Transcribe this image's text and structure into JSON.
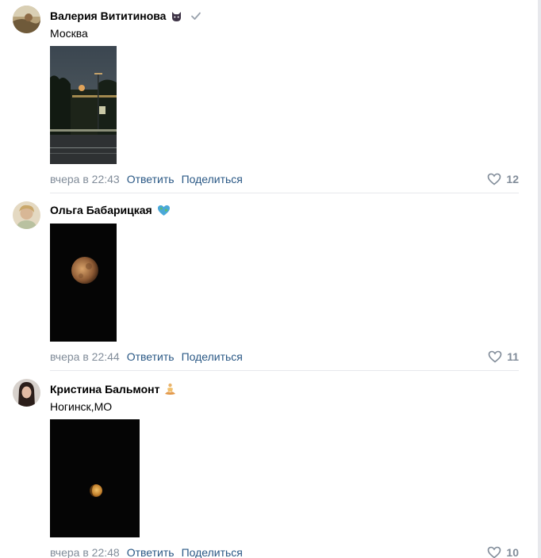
{
  "comments": [
    {
      "author": "Валерия Вититинова",
      "emoji": "cat-face-emoji-icon",
      "verified_icon": "checkmark-icon",
      "text": "Москва",
      "photo": "moon-over-street-photo",
      "date": "вчера в 22:43",
      "reply_label": "Ответить",
      "share_label": "Поделиться",
      "likes": "12"
    },
    {
      "author": "Ольга Бабарицкая",
      "emoji": "globe-heart-emoji-icon",
      "photo": "eclipse-moon-photo",
      "date": "вчера в 22:44",
      "reply_label": "Ответить",
      "share_label": "Поделиться",
      "likes": "11"
    },
    {
      "author": "Кристина Бальмонт",
      "emoji": "person-lotus-emoji-icon",
      "text": "Ногинск,МО",
      "photo": "small-moon-night-photo",
      "date": "вчера в 22:48",
      "reply_label": "Ответить",
      "share_label": "Поделиться",
      "likes": "10"
    }
  ],
  "colors": {
    "link": "#2a5885",
    "meta": "#818c99",
    "separator": "#e7e8ec"
  }
}
